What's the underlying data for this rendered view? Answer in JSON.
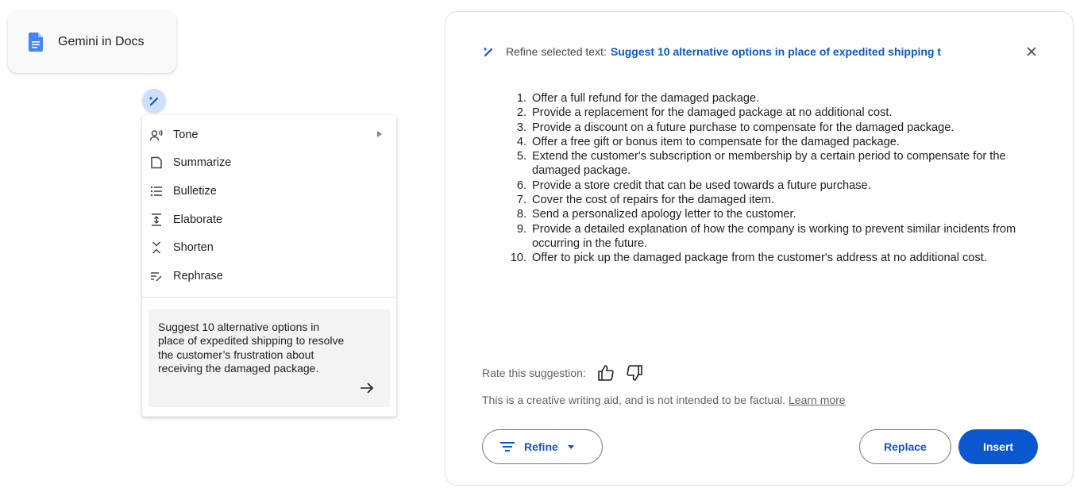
{
  "chip": {
    "label": "Gemini in Docs",
    "icon": "docs-icon",
    "icon_color": "#4285f4"
  },
  "menu": {
    "items": [
      {
        "label": "Tone",
        "icon": "tone-icon",
        "has_submenu": true
      },
      {
        "label": "Summarize",
        "icon": "summarize-icon"
      },
      {
        "label": "Bulletize",
        "icon": "bulletize-icon"
      },
      {
        "label": "Elaborate",
        "icon": "elaborate-icon"
      },
      {
        "label": "Shorten",
        "icon": "shorten-icon"
      },
      {
        "label": "Rephrase",
        "icon": "rephrase-icon"
      }
    ],
    "prompt": "Suggest 10 alternative options in place of expedited shipping to resolve the customer’s frustration about receiving the damaged package."
  },
  "panel": {
    "header_label": "Refine selected text:",
    "header_query": "Suggest 10 alternative options in place of expedited shipping t",
    "suggestions": [
      "Offer a full refund for the damaged package.",
      "Provide a replacement for the damaged package at no additional cost.",
      "Provide a discount on a future purchase to compensate for the damaged package.",
      "Offer a free gift or bonus item to compensate for the damaged package.",
      "Extend the customer's subscription or membership by a certain period to compensate for the damaged package.",
      "Provide a store credit that can be used towards a future purchase.",
      "Cover the cost of repairs for the damaged item.",
      "Send a personalized apology letter to the customer.",
      "Provide a detailed explanation of how the company is working to prevent similar incidents from occurring in the future.",
      "Offer to pick up the damaged package from the customer's address at no additional cost."
    ],
    "rate_label": "Rate this suggestion:",
    "disclaimer": "This is a creative writing aid, and is not intended to be factual.",
    "learn_more": "Learn more",
    "refine_label": "Refine",
    "replace_label": "Replace",
    "insert_label": "Insert"
  },
  "colors": {
    "accent": "#0b57d0",
    "spark_bg": "#cfe0fc",
    "prompt_bg": "#f1f3f4"
  }
}
